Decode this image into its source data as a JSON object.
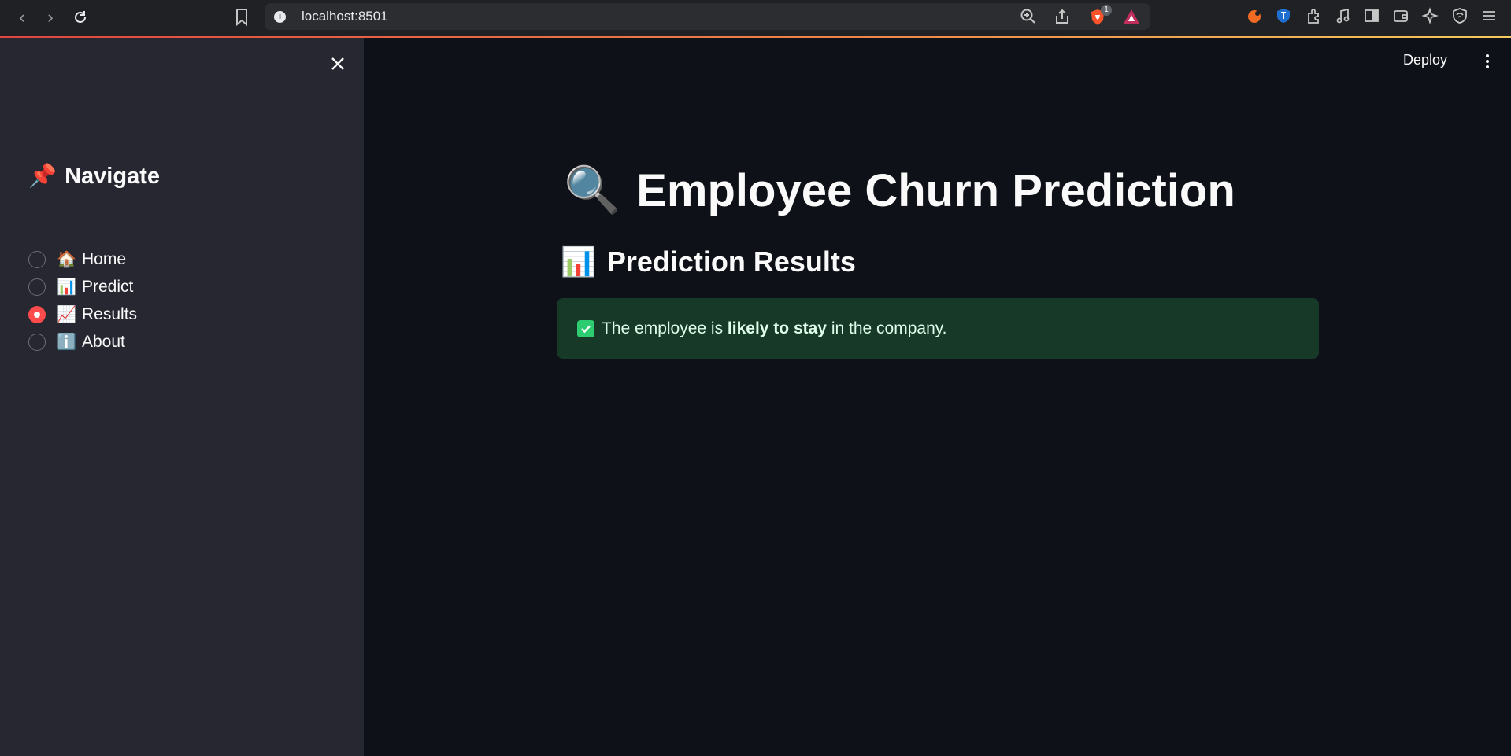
{
  "browser": {
    "url": "localhost:8501",
    "brave_badge_count": "1"
  },
  "sidebar": {
    "title_emoji": "📌",
    "title": "Navigate",
    "items": [
      {
        "emoji": "🏠",
        "label": "Home",
        "selected": false
      },
      {
        "emoji": "📊",
        "label": "Predict",
        "selected": false
      },
      {
        "emoji": "📈",
        "label": "Results",
        "selected": true
      },
      {
        "emoji": "ℹ️",
        "label": "About",
        "selected": false
      }
    ]
  },
  "header": {
    "deploy_label": "Deploy"
  },
  "main": {
    "title_emoji": "🔍",
    "title": "Employee Churn Prediction",
    "subtitle_emoji": "📊",
    "subtitle": "Prediction Results",
    "alert": {
      "icon": "✅",
      "prefix": "The employee is",
      "bold": "likely to stay",
      "suffix": "in the company."
    }
  },
  "colors": {
    "accent": "#ff4b4b",
    "success_bg": "#173928",
    "sidebar_bg": "#262730",
    "main_bg": "#0e1117"
  }
}
